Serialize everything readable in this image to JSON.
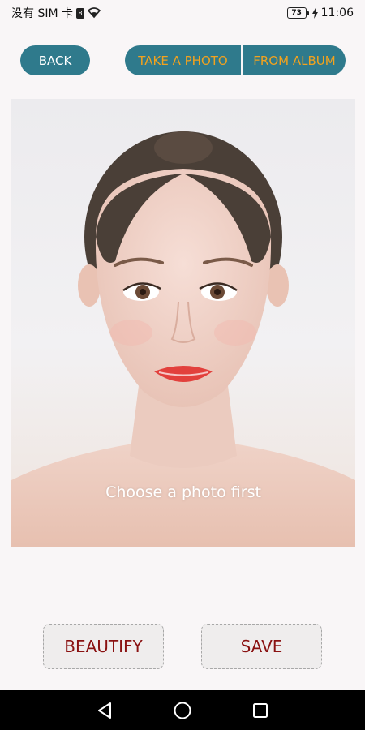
{
  "status_bar": {
    "carrier": "没有 SIM 卡",
    "sim_badge": "8",
    "battery": "73",
    "time": "11:06"
  },
  "header": {
    "back_label": "BACK",
    "take_photo_label": "TAKE A PHOTO",
    "from_album_label": "FROM ALBUM"
  },
  "photo": {
    "caption": "Choose a photo first"
  },
  "actions": {
    "beautify_label": "BEAUTIFY",
    "save_label": "SAVE"
  },
  "nav": {
    "back_icon": "triangle-back-icon",
    "home_icon": "circle-home-icon",
    "recents_icon": "square-recents-icon"
  },
  "colors": {
    "accent": "#2f7a8c",
    "accent_text": "#f2a21e",
    "action_text": "#8a1212"
  }
}
